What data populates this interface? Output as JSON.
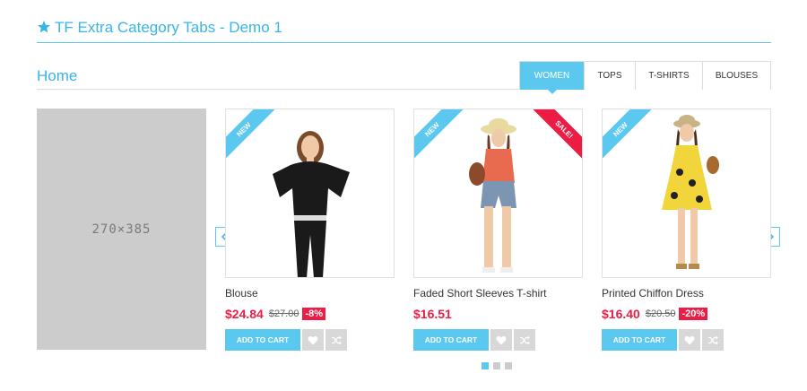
{
  "module": {
    "title": "TF Extra Category Tabs - Demo 1",
    "icon": "star-icon"
  },
  "category": {
    "home_label": "Home"
  },
  "tabs": [
    {
      "label": "WOMEN",
      "active": true
    },
    {
      "label": "TOPS",
      "active": false
    },
    {
      "label": "T-SHIRTS",
      "active": false
    },
    {
      "label": "BLOUSES",
      "active": false
    }
  ],
  "banner": {
    "placeholder_text": "270×385"
  },
  "products": [
    {
      "name": "Blouse",
      "price": "$24.84",
      "old_price": "$27.00",
      "discount": "-8%",
      "badge_new": "NEW",
      "badge_sale": "",
      "outfit_color": "#1a1a1a"
    },
    {
      "name": "Faded Short Sleeves T-shirt",
      "price": "$16.51",
      "old_price": "",
      "discount": "",
      "badge_new": "NEW",
      "badge_sale": "SALE!",
      "outfit_color": "#e86a4f"
    },
    {
      "name": "Printed Chiffon Dress",
      "price": "$16.40",
      "old_price": "$20.50",
      "discount": "-20%",
      "badge_new": "NEW",
      "badge_sale": "",
      "outfit_color": "#f2d43b"
    }
  ],
  "buttons": {
    "add_to_cart": "ADD TO CART"
  },
  "pagination": {
    "pages": 3,
    "active_page": 1
  },
  "colors": {
    "accent": "#5bc8ef",
    "title": "#37b5e7",
    "sale": "#ed1c45"
  }
}
